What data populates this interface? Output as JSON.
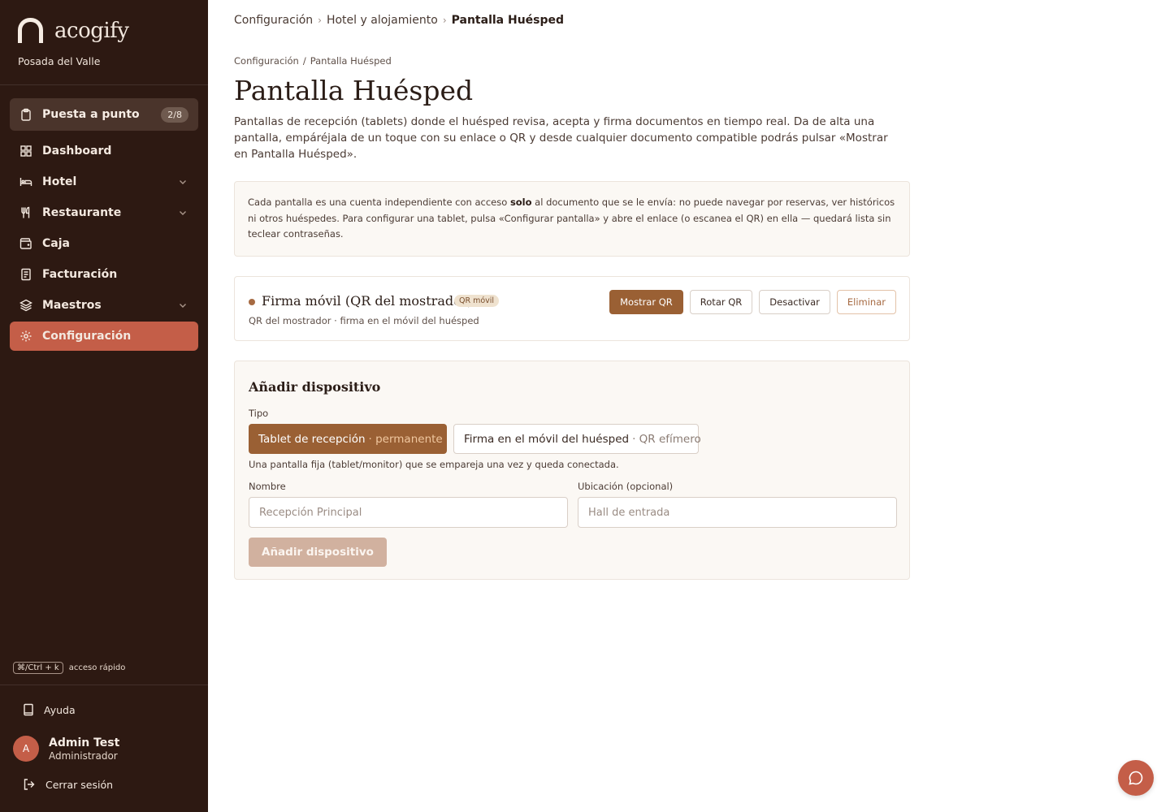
{
  "brand": {
    "name": "acogify",
    "hotel": "Posada del Valle"
  },
  "sidebar": {
    "setup": {
      "label": "Puesta a punto",
      "badge": "2/8"
    },
    "items": [
      {
        "label": "Dashboard",
        "icon": "grid-icon"
      },
      {
        "label": "Hotel",
        "icon": "bed-icon",
        "expandable": true
      },
      {
        "label": "Restaurante",
        "icon": "utensils-icon",
        "expandable": true
      },
      {
        "label": "Caja",
        "icon": "wallet-icon"
      },
      {
        "label": "Facturación",
        "icon": "receipt-icon"
      },
      {
        "label": "Maestros",
        "icon": "layers-icon",
        "expandable": true
      },
      {
        "label": "Configuración",
        "icon": "gear-icon",
        "active": true
      }
    ],
    "shortcut": {
      "key": "⌘/Ctrl + k",
      "label": "acceso rápido"
    },
    "help": "Ayuda",
    "user": {
      "initial": "A",
      "name": "Admin Test",
      "role": "Administrador"
    },
    "logout": "Cerrar sesión"
  },
  "breadcrumb": {
    "items": [
      "Configuración",
      "Hotel y alojamiento"
    ],
    "current": "Pantalla Huésped"
  },
  "subcrumb": {
    "parent": "Configuración",
    "sep": "/",
    "current": "Pantalla Huésped"
  },
  "page": {
    "title": "Pantalla Huésped",
    "intro": "Pantallas de recepción (tablets) donde el huésped revisa, acepta y firma documentos en tiempo real. Da de alta una pantalla, empáréjala de un toque con su enlace o QR y desde cualquier documento compatible podrás pulsar «Mostrar en Pantalla Huésped»."
  },
  "info": {
    "pre": "Cada pantalla es una cuenta independiente con acceso ",
    "bold": "solo",
    "post": " al documento que se le envía: no puede navegar por reservas, ver históricos ni otros huéspedes. Para configurar una tablet, pulsa «Configurar pantalla» y abre el enlace (o escanea el QR) en ella — quedará lista sin teclear contraseñas."
  },
  "device": {
    "name": "Firma móvil (QR del mostrador)",
    "tag": "QR móvil",
    "subtitle": "QR del mostrador · firma en el móvil del huésped",
    "actions": {
      "show_qr": "Mostrar QR",
      "rotate_qr": "Rotar QR",
      "deactivate": "Desactivar",
      "delete": "Eliminar"
    }
  },
  "add_device": {
    "title": "Añadir dispositivo",
    "type_label": "Tipo",
    "types": [
      {
        "label": "Tablet de recepción",
        "hint": "· permanente",
        "selected": true
      },
      {
        "label": "Firma en el móvil del huésped",
        "hint": "· QR efímero",
        "selected": false
      }
    ],
    "type_help": "Una pantalla fija (tablet/monitor) que se empareja una vez y queda conectada.",
    "name_label": "Nombre",
    "name_placeholder": "Recepción Principal",
    "location_label": "Ubicación (opcional)",
    "location_placeholder": "Hall de entrada",
    "submit": "Añadir dispositivo"
  },
  "colors": {
    "sidebar_bg": "#2d1912",
    "accent": "#c45e48",
    "primary_button": "#9a6034"
  }
}
